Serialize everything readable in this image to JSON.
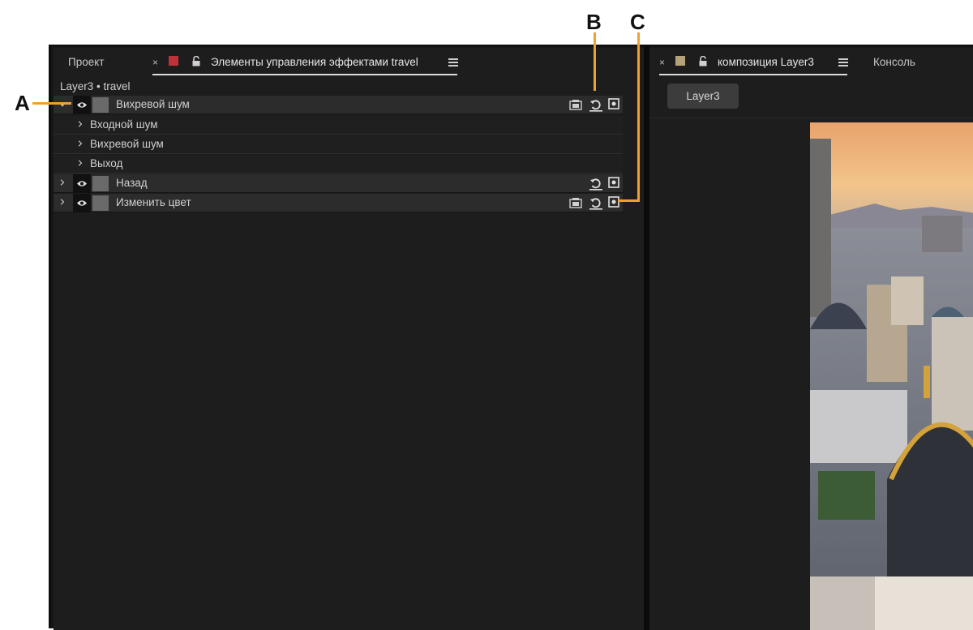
{
  "left_panel": {
    "tabs": [
      {
        "label": "Проект"
      },
      {
        "label": "Элементы управления эффектами travel"
      }
    ],
    "close_glyph": "×",
    "layer_title": "Layer3 • travel",
    "swatch_color": "#c0323a",
    "effects": [
      {
        "label": "Вихревой шум",
        "expanded": true,
        "icons": [
          "fx-preset-icon",
          "reset-icon",
          "keyframe-icon"
        ]
      },
      {
        "label": "Входной шум",
        "type": "property"
      },
      {
        "label": "Вихревой шум",
        "type": "property"
      },
      {
        "label": "Выход",
        "type": "property"
      },
      {
        "label": "Назад",
        "expanded": false,
        "icons": [
          "reset-icon",
          "keyframe-icon"
        ]
      },
      {
        "label": "Изменить цвет",
        "expanded": false,
        "icons": [
          "fx-preset-icon",
          "reset-icon",
          "keyframe-icon"
        ]
      }
    ]
  },
  "right_panel": {
    "close_glyph": "×",
    "swatch_color": "#b5a27a",
    "tabs": [
      {
        "label": "композиция Layer3"
      },
      {
        "label": "Консоль"
      }
    ],
    "comp_button": "Layer3"
  },
  "callouts": {
    "a": "A",
    "b": "B",
    "c": "C",
    "color": "#f0a030"
  }
}
